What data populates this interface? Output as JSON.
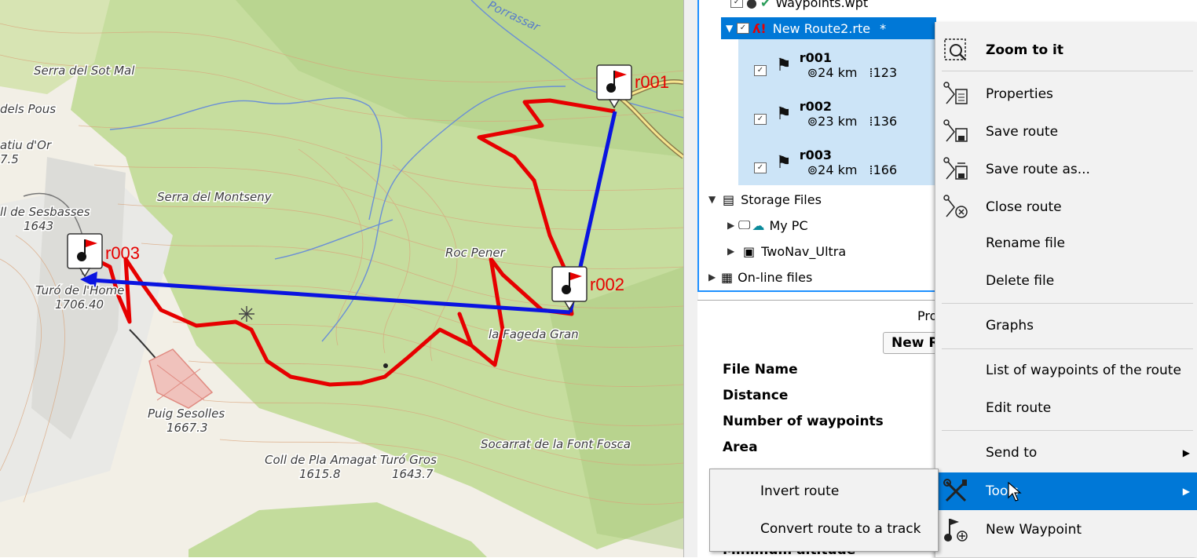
{
  "colors": {
    "route_red": "#e60000",
    "route_blue": "#0a14e0",
    "selection": "#0078d7",
    "selection_light": "#cce4f7",
    "menu_bg": "#f2f2f2"
  },
  "map": {
    "labels": [
      {
        "text": "Serra del Sot Mal"
      },
      {
        "text": "dels Pous"
      },
      {
        "text": "atiu d'Or"
      },
      {
        "text": "7.5"
      },
      {
        "text": "ll de Sesbasses"
      },
      {
        "text": "1643"
      },
      {
        "text": "Serra del Montseny"
      },
      {
        "text": "Turó de l'Home"
      },
      {
        "text": "1706.40"
      },
      {
        "text": "Roc Pener"
      },
      {
        "text": "la Fageda Gran"
      },
      {
        "text": "Puig Sesolles"
      },
      {
        "text": "1667.3"
      },
      {
        "text": "Socarrat de la Font Fosca"
      },
      {
        "text": "Coll de Pla Amagat Turó Gros"
      },
      {
        "text": "1615.8"
      },
      {
        "text": "1643.7"
      },
      {
        "text": "Porrassar"
      }
    ],
    "waypoints": {
      "r001": "r001",
      "r002": "r002",
      "r003": "r003"
    },
    "icons": {
      "waypoint": "flag-marker-icon",
      "summit": "sun-symbol-icon"
    }
  },
  "tree": {
    "waypoints_file": "Waypoints.wpt",
    "route_file": "New Route2.rte",
    "modified_marker": "*",
    "items": [
      {
        "name": "r001",
        "dist": "24 km",
        "alt": "123"
      },
      {
        "name": "r002",
        "dist": "23 km",
        "alt": "136"
      },
      {
        "name": "r003",
        "dist": "24 km",
        "alt": "166"
      }
    ],
    "storage": "Storage Files",
    "my_pc": "My PC",
    "device": "TwoNav_Ultra",
    "online": "On-line files"
  },
  "properties": {
    "heading": "Pro",
    "name_field": "New R",
    "labels": [
      "File Name",
      "Distance",
      "Number of waypoints",
      "Area",
      "Minimum altitude"
    ]
  },
  "context_menu": {
    "zoom": "Zoom to it",
    "properties": "Properties",
    "save": "Save route",
    "save_as": "Save route as...",
    "close": "Close route",
    "rename": "Rename file",
    "delete": "Delete file",
    "graphs": "Graphs",
    "list_wp": "List of waypoints of the route",
    "edit": "Edit route",
    "send": "Send to",
    "tools": "Tools",
    "new_wp": "New Waypoint"
  },
  "submenu": {
    "invert": "Invert route",
    "convert": "Convert route to a track"
  }
}
